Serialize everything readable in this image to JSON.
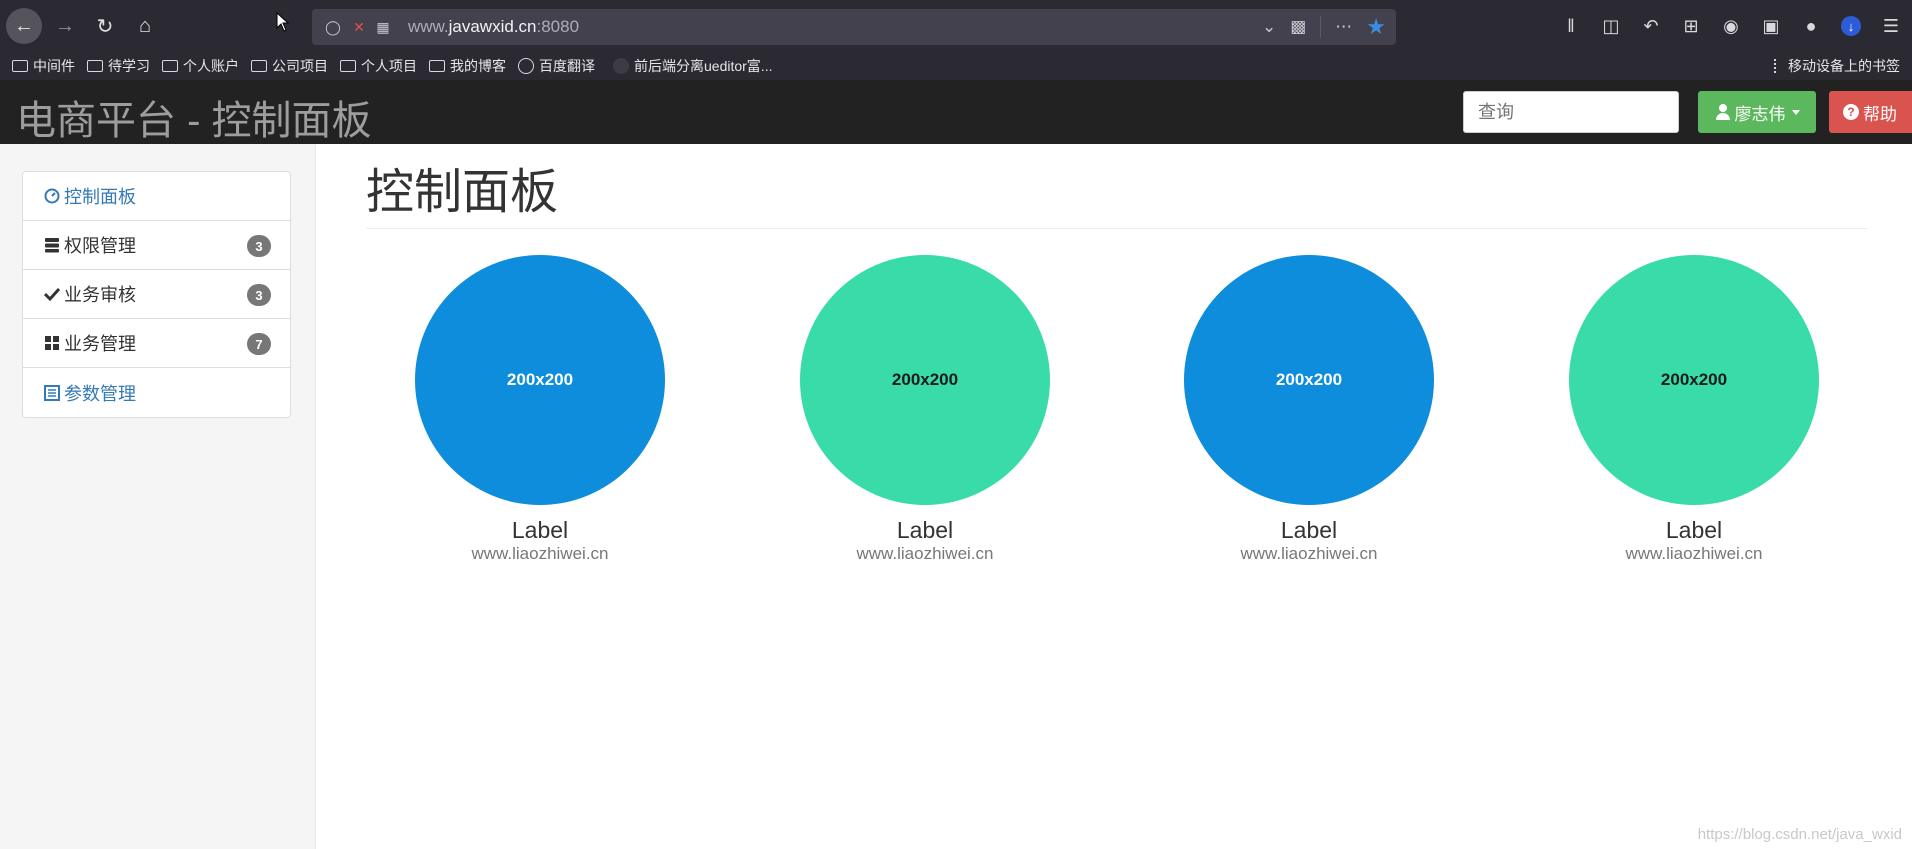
{
  "browser": {
    "url_prefix": "www.",
    "url_host": "javawxid.cn",
    "url_port": ":8080",
    "bookmarks": [
      "中间件",
      "待学习",
      "个人账户",
      "公司项目",
      "个人项目",
      "我的博客",
      "百度翻译",
      "前后端分离ueditor富..."
    ],
    "mobile_bookmarks": "移动设备上的书签"
  },
  "navbar": {
    "brand": "电商平台 - 控制面板",
    "search_placeholder": "查询",
    "user_label": "廖志伟",
    "help_label": "帮助"
  },
  "sidebar": {
    "items": [
      {
        "label": "控制面板",
        "badge": ""
      },
      {
        "label": "权限管理",
        "badge": "3"
      },
      {
        "label": "业务审核",
        "badge": "3"
      },
      {
        "label": "业务管理",
        "badge": "7"
      },
      {
        "label": "参数管理",
        "badge": ""
      }
    ]
  },
  "main": {
    "title": "控制面板",
    "placeholders": [
      {
        "image_text": "200x200",
        "label": "Label",
        "sub": "www.liaozhiwei.cn",
        "color": "#0d8ddb"
      },
      {
        "image_text": "200x200",
        "label": "Label",
        "sub": "www.liaozhiwei.cn",
        "color": "#39dba8"
      },
      {
        "image_text": "200x200",
        "label": "Label",
        "sub": "www.liaozhiwei.cn",
        "color": "#0d8ddb"
      },
      {
        "image_text": "200x200",
        "label": "Label",
        "sub": "www.liaozhiwei.cn",
        "color": "#39dba8"
      }
    ]
  },
  "watermark": "https://blog.csdn.net/java_wxid"
}
